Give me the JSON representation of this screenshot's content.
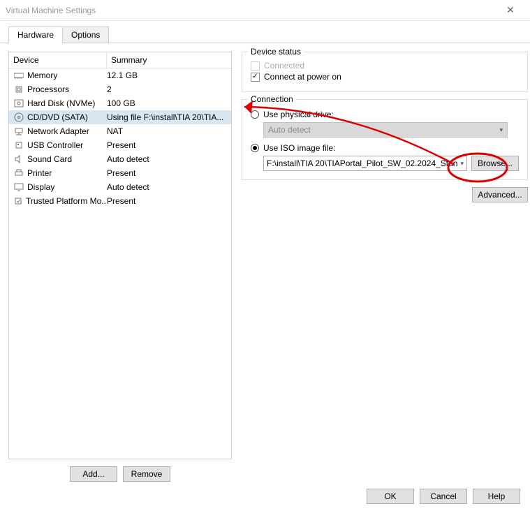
{
  "window": {
    "title": "Virtual Machine Settings"
  },
  "tabs": {
    "hardware": "Hardware",
    "options": "Options"
  },
  "table": {
    "col_device": "Device",
    "col_summary": "Summary",
    "rows": [
      {
        "device": "Memory",
        "summary": "12.1 GB"
      },
      {
        "device": "Processors",
        "summary": "2"
      },
      {
        "device": "Hard Disk (NVMe)",
        "summary": "100 GB"
      },
      {
        "device": "CD/DVD (SATA)",
        "summary": "Using file F:\\install\\TIA 20\\TIA..."
      },
      {
        "device": "Network Adapter",
        "summary": "NAT"
      },
      {
        "device": "USB Controller",
        "summary": "Present"
      },
      {
        "device": "Sound Card",
        "summary": "Auto detect"
      },
      {
        "device": "Printer",
        "summary": "Present"
      },
      {
        "device": "Display",
        "summary": "Auto detect"
      },
      {
        "device": "Trusted Platform Mo...",
        "summary": "Present"
      }
    ]
  },
  "buttons": {
    "add": "Add...",
    "remove": "Remove",
    "browse": "Browse...",
    "advanced": "Advanced...",
    "ok": "OK",
    "cancel": "Cancel",
    "help": "Help"
  },
  "status": {
    "group": "Device status",
    "connected": "Connected",
    "connect_power": "Connect at power on"
  },
  "connection": {
    "group": "Connection",
    "physical": "Use physical drive:",
    "auto_detect": "Auto detect",
    "iso": "Use ISO image file:",
    "iso_path": "F:\\install\\TIA 20\\TIAPortal_Pilot_SW_02.2024_Stan"
  }
}
